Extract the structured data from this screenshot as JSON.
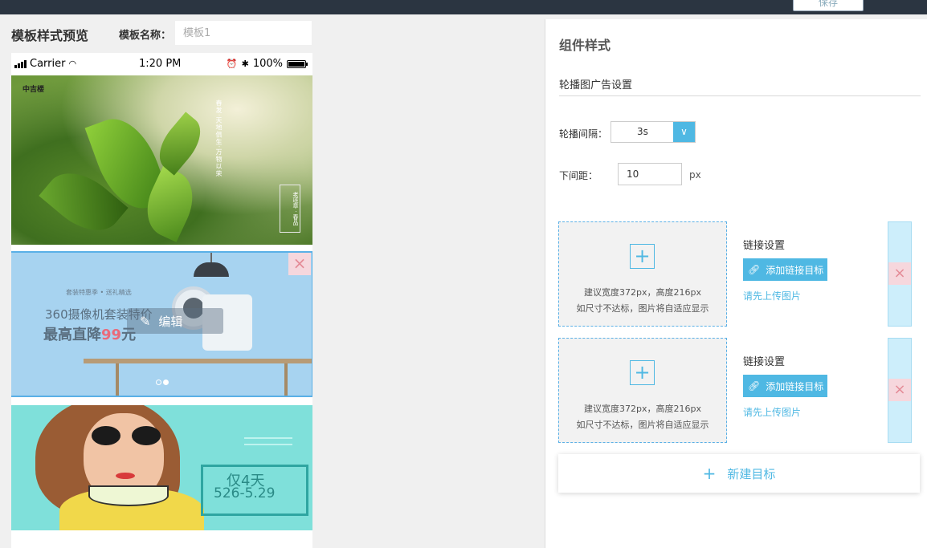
{
  "header": {
    "save_label": "保存"
  },
  "preview": {
    "title": "模板样式预览",
    "name_label": "模板名称：",
    "name_placeholder": "模板1"
  },
  "phone": {
    "carrier": "Carrier",
    "time": "1:20 PM",
    "battery": "100%"
  },
  "banners": [
    {
      "logo": "中吉楼",
      "poem": "春发·天地俱生·万物以荣",
      "stamp": "老班章 · 春品"
    },
    {
      "small": "套装特惠季 • 送礼精选",
      "headline": "360摄像机套装特价",
      "big_prefix": "最高直降",
      "big_price": "99",
      "big_suffix": "元",
      "edit_label": "编辑",
      "close_icon": "×"
    },
    {
      "line1": "仅4天",
      "line2": "526-5.29"
    }
  ],
  "panel": {
    "title": "组件样式",
    "section_title": "轮播图广告设置",
    "interval_label": "轮播间隔：",
    "interval_value": "3s",
    "margin_label": "下间距：",
    "margin_value": "10",
    "margin_unit": "px"
  },
  "cards": [
    {
      "upload_hint1": "建议宽度372px，高度216px",
      "upload_hint2": "如尺寸不达标，图片将自适应显示",
      "link_title": "链接设置",
      "link_button": "添加链接目标",
      "upload_first": "请先上传图片",
      "delete_icon": "×"
    },
    {
      "upload_hint1": "建议宽度372px，高度216px",
      "upload_hint2": "如尺寸不达标，图片将自适应显示",
      "link_title": "链接设置",
      "link_button": "添加链接目标",
      "upload_first": "请先上传图片",
      "delete_icon": "×"
    }
  ],
  "new_target_label": "新建目标",
  "colors": {
    "accent": "#4fb8e3",
    "topbar": "#2b3541",
    "danger_bg": "#f6d7dd"
  }
}
